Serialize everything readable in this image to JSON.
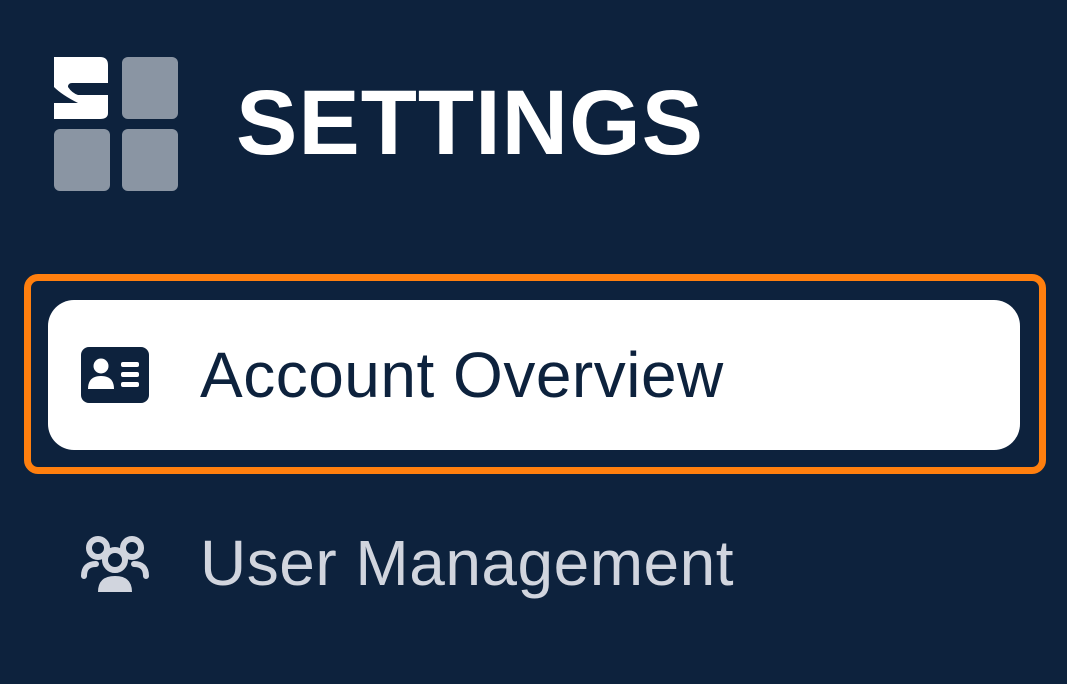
{
  "header": {
    "title": "SETTINGS",
    "logo_icon": "settings-grid-logo-icon"
  },
  "nav": {
    "items": [
      {
        "label": "Account Overview",
        "icon": "id-card-icon",
        "active": true
      },
      {
        "label": "User Management",
        "icon": "users-icon",
        "active": false
      }
    ]
  },
  "colors": {
    "background": "#0d223d",
    "active_item_bg": "#ffffff",
    "active_text": "#0d223d",
    "inactive_text": "#d1d5de",
    "highlight_border": "#ff7f0e",
    "logo_tile": "#8a95a3"
  }
}
